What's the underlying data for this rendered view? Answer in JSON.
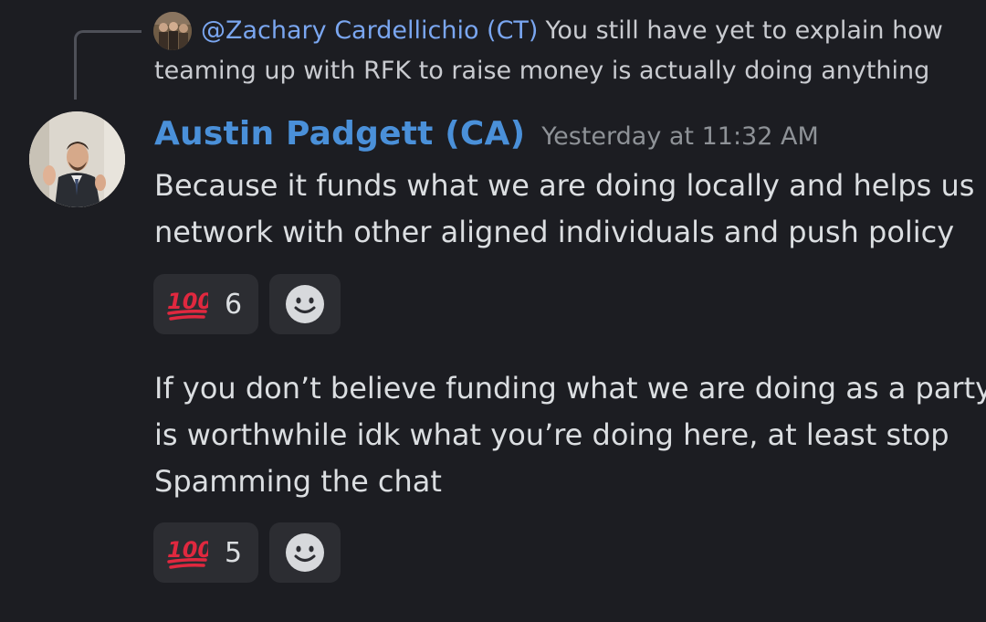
{
  "reply": {
    "author": "@Zachary Cardellichio (CT)",
    "text_line1": "You still have yet to explain how",
    "text_line2": "teaming up with RFK to raise money is actually doing anything"
  },
  "message": {
    "author": "Austin Padgett (CA)",
    "timestamp": "Yesterday at 11:32 AM",
    "content1": {
      "line1": "Because it funds what we are doing locally and helps us",
      "line2": "network with other aligned individuals and push policy"
    },
    "content2": {
      "line1": "If you don’t believe funding what we are doing as a party",
      "line2": "is worthwhile idk what you’re doing here, at least stop",
      "line3": "Spamming the chat"
    }
  },
  "reactions1": {
    "emoji": "100-emoji",
    "count": "6"
  },
  "reactions2": {
    "emoji": "100-emoji",
    "count": "5"
  },
  "icons": {
    "add_reaction": "smile-icon"
  },
  "colors": {
    "background": "#1c1d22",
    "author": "#4a90d9",
    "mention": "#7aa6f0",
    "reaction_bg": "#2c2d32",
    "hundred_red": "#e0283f"
  }
}
